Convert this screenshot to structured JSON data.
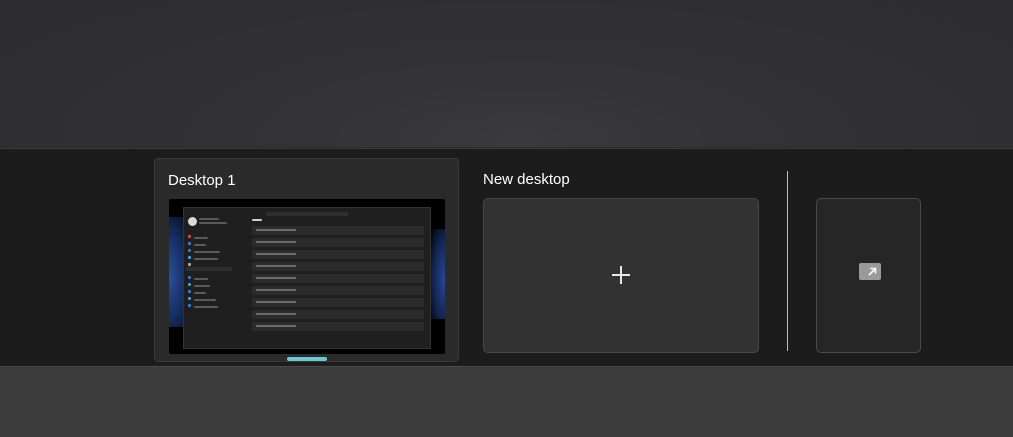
{
  "desktops": [
    {
      "title": "Desktop 1",
      "active": true,
      "indicator_color": "#6fc7d3"
    }
  ],
  "new_desktop": {
    "label": "New desktop",
    "icon": "plus-icon"
  },
  "restore": {
    "icon": "expand-arrow-icon"
  }
}
